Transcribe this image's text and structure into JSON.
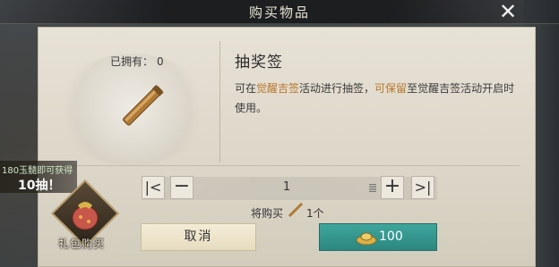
{
  "header": {
    "title": "购买物品",
    "close_icon": "close-icon"
  },
  "item": {
    "owned_label": "已拥有：",
    "owned_count": "0",
    "name": "抽奖签",
    "desc_part1": "可在",
    "desc_hl1": "觉醒吉签",
    "desc_part2": "活动进行抽签，",
    "desc_hl2": "可保留",
    "desc_part3": "至觉醒吉签活动开启时使用。",
    "icon": "lottery-stick-icon"
  },
  "quantity": {
    "value": "1",
    "will_buy_label": "将购买",
    "buy_count": "1个",
    "min_icon": "skip-to-min-icon",
    "minus_icon": "minus-icon",
    "plus_icon": "plus-icon",
    "max_icon": "skip-to-max-icon"
  },
  "buttons": {
    "cancel_label": "取消",
    "buy_price": "100",
    "currency_icon": "ingot-icon"
  },
  "promo": {
    "line1": "180玉髓即可获得",
    "line2": "10抽！",
    "gift_label": "礼包购买",
    "gift_icon": "gift-bag-icon"
  },
  "colors": {
    "highlight": "#b9752a",
    "buy_button": "#2f8f88",
    "panel": "#e2ddd0"
  }
}
